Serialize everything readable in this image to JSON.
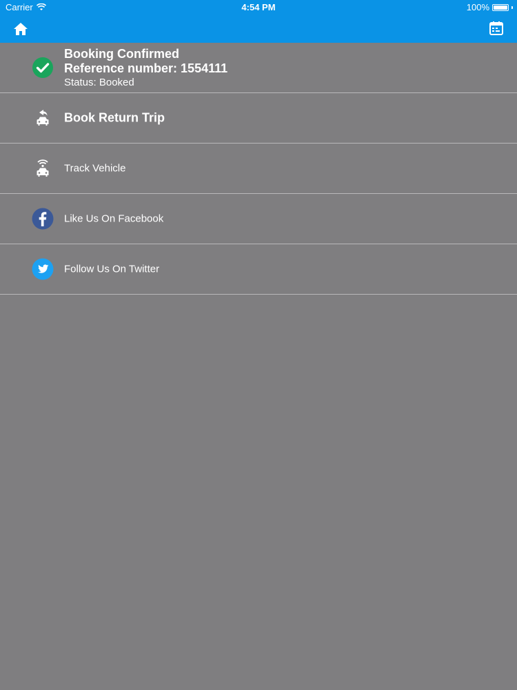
{
  "status_bar": {
    "carrier": "Carrier",
    "time": "4:54 PM",
    "battery": "100%",
    "battery_level": 1.0
  },
  "nav": {
    "home_icon": "home-icon",
    "calendar_icon": "calendar-icon"
  },
  "booking": {
    "title": "Booking Confirmed",
    "reference": "Reference number: 1554111",
    "status": "Status: Booked"
  },
  "menu": {
    "items": [
      {
        "label": "Book Return Trip",
        "icon": "return-trip-car-icon"
      },
      {
        "label": "Track Vehicle",
        "icon": "track-vehicle-icon"
      },
      {
        "label": "Like Us On Facebook",
        "icon": "facebook-icon"
      },
      {
        "label": "Follow Us On Twitter",
        "icon": "twitter-icon"
      }
    ]
  },
  "colors": {
    "accent": "#0a93e6",
    "background": "#7f7e80",
    "success": "#1aa55c",
    "facebook": "#3b5998",
    "twitter": "#1da1f2"
  }
}
